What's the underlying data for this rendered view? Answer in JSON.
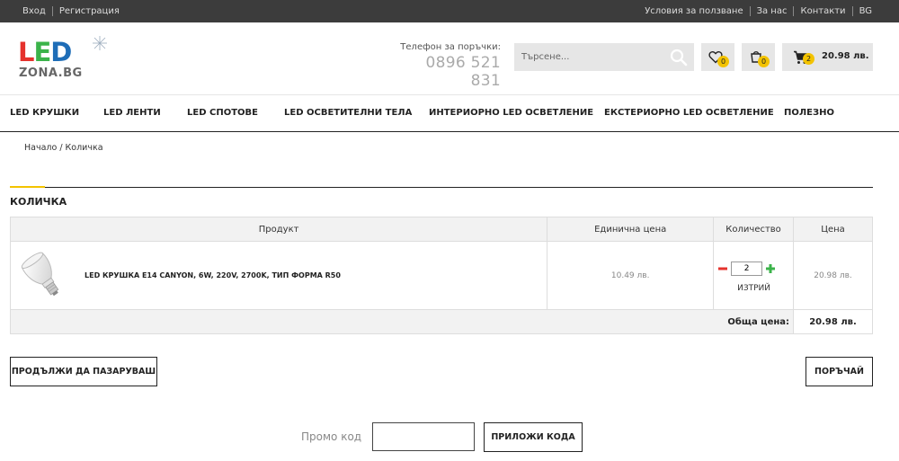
{
  "topbar": {
    "login": "Вход",
    "register": "Регистрация",
    "terms": "Условия за ползване",
    "about": "За нас",
    "contacts": "Контакти",
    "lang": "BG"
  },
  "header": {
    "logo_led": [
      "L",
      "E",
      "D"
    ],
    "logo_zona": "ZONA.BG",
    "phone_label": "Телефон за поръчки:",
    "phone_number": "0896 521 831",
    "search_placeholder": "Търсене...",
    "wishlist_count": "0",
    "compare_count": "0",
    "cart_count": "2",
    "cart_total": "20.98 лв."
  },
  "nav": {
    "items": [
      "LED КРУШКИ",
      "LED ЛЕНТИ",
      "LED СПОТОВЕ",
      "LED ОСВЕТИТЕЛНИ ТЕЛА",
      "ИНТЕРИОРНО LED ОСВЕТЛЕНИЕ",
      "ЕКСТЕРИОРНО LED ОСВЕТЛЕНИЕ",
      "ПОЛЕЗНО"
    ]
  },
  "breadcrumb": {
    "home": "Начало",
    "separator": " / ",
    "current": "Количка"
  },
  "section_title": "КОЛИЧКА",
  "table": {
    "headers": [
      "Продукт",
      "Единична цена",
      "Количество",
      "Цена"
    ],
    "rows": [
      {
        "name": "LED КРУШКА E14 CANYON, 6W, 220V, 2700K, ТИП ФОРМА R50",
        "unit_price": "10.49 лв.",
        "quantity": "2",
        "remove": "ИЗТРИЙ",
        "price": "20.98 лв."
      }
    ],
    "total_label": "Обща цена:",
    "total_value": "20.98 лв."
  },
  "buttons": {
    "continue": "ПРОДЪЛЖИ ДА ПАЗАРУВАШ",
    "checkout": "ПОРЪЧАЙ",
    "apply_code": "ПРИЛОЖИ КОДА"
  },
  "promo": {
    "label": "Промо код",
    "value": ""
  },
  "colors": {
    "topbar_bg": "#3c3c3c",
    "accent_yellow": "#f3c300",
    "minus_red": "#e5322d",
    "plus_green": "#3bb34a"
  }
}
